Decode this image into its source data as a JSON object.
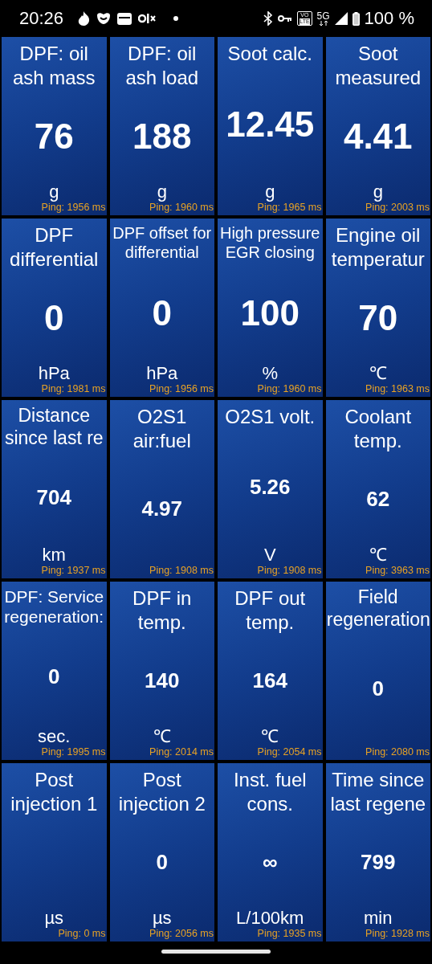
{
  "status_bar": {
    "time": "20:26",
    "volte": [
      "VO",
      "LTE"
    ],
    "network": "5G",
    "battery": "100 %"
  },
  "gauges": [
    {
      "title": "DPF: oil ash mass",
      "value": "76",
      "unit": "g",
      "ping": "Ping: 1956 ms"
    },
    {
      "title": "DPF: oil ash load",
      "value": "188",
      "unit": "g",
      "ping": "Ping: 1960 ms"
    },
    {
      "title": "Soot calc.",
      "value": "12.45",
      "unit": "g",
      "ping": "Ping: 1965 ms"
    },
    {
      "title": "Soot measured",
      "value": "4.41",
      "unit": "g",
      "ping": "Ping: 2003 ms"
    },
    {
      "title": "DPF differential",
      "value": "0",
      "unit": "hPa",
      "ping": "Ping: 1981 ms"
    },
    {
      "title": "DPF offset for differential",
      "value": "0",
      "unit": "hPa",
      "ping": "Ping: 1956 ms"
    },
    {
      "title": "High pressure EGR closing",
      "value": "100",
      "unit": "%",
      "ping": "Ping: 1960 ms"
    },
    {
      "title": "Engine oil temperatur",
      "value": "70",
      "unit": "℃",
      "ping": "Ping: 1963 ms"
    },
    {
      "title": "Distance since last re",
      "value": "704",
      "unit": "km",
      "ping": "Ping: 1937 ms"
    },
    {
      "title": "O2S1 air:fuel",
      "value": "4.97",
      "ping": "Ping: 1908 ms"
    },
    {
      "title": "O2S1 volt.",
      "value": "5.26",
      "unit": "V",
      "ping": "Ping: 1908 ms"
    },
    {
      "title": "Coolant temp.",
      "value": "62",
      "unit": "℃",
      "ping": "Ping: 3963 ms"
    },
    {
      "title": "DPF: Service regeneration:",
      "value": "0",
      "unit": "sec.",
      "ping": "Ping: 1995 ms"
    },
    {
      "title": "DPF in temp.",
      "value": "140",
      "unit": "℃",
      "ping": "Ping: 2014 ms"
    },
    {
      "title": "DPF out temp.",
      "value": "164",
      "unit": "℃",
      "ping": "Ping: 2054 ms"
    },
    {
      "title": "Field regeneration",
      "value": "0",
      "ping": "Ping: 2080 ms"
    },
    {
      "title": "Post injection 1",
      "unit": "µs",
      "ping": "Ping: 0 ms"
    },
    {
      "title": "Post injection 2",
      "value": "0",
      "unit": "µs",
      "ping": "Ping: 2056 ms"
    },
    {
      "title": "Inst. fuel cons.",
      "value": "∞",
      "unit": "L/100km",
      "ping": "Ping: 1935 ms"
    },
    {
      "title": "Time since last regene",
      "value": "799",
      "unit": "min",
      "ping": "Ping: 1928 ms"
    }
  ]
}
